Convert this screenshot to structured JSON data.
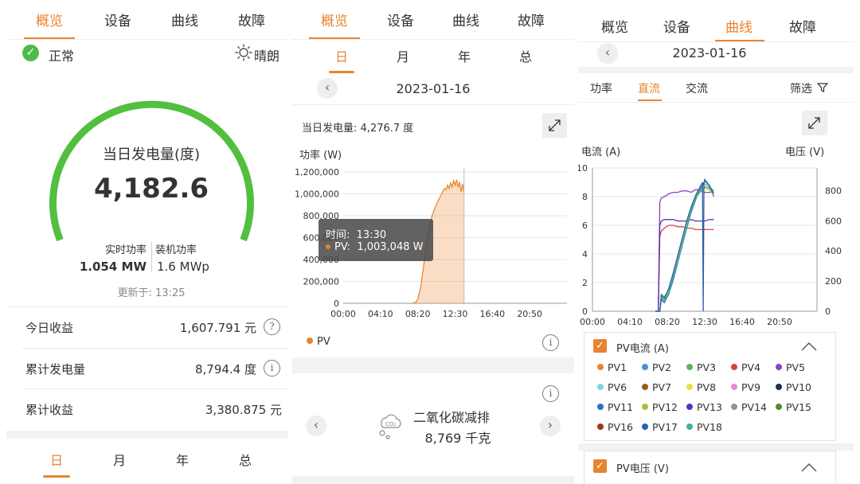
{
  "panel1": {
    "tabs": [
      "概览",
      "设备",
      "曲线",
      "故障"
    ],
    "active_tab": 0,
    "status_text": "正常",
    "weather_text": "晴朗",
    "gauge_title": "当日发电量(度)",
    "gauge_value": "4,182.6",
    "realtime_power_label": "实时功率",
    "realtime_power_value": "1.054",
    "realtime_power_unit": "MW",
    "installed_power_label": "装机功率",
    "installed_power_value": "1.6",
    "installed_power_unit": "MWp",
    "updated_label": "更新于:",
    "updated_time": "13:25",
    "rows": [
      {
        "label": "今日收益",
        "value": "1,607.791 元"
      },
      {
        "label": "累计发电量",
        "value": "8,794.4 度"
      },
      {
        "label": "累计收益",
        "value": "3,380.875 元"
      }
    ],
    "bottom_tabs": [
      "日",
      "月",
      "年",
      "总"
    ]
  },
  "panel2": {
    "tabs": [
      "概览",
      "设备",
      "曲线",
      "故障"
    ],
    "active_tab": 0,
    "period_tabs": [
      "日",
      "月",
      "年",
      "总"
    ],
    "date": "2023-01-16",
    "energy_label": "当日发电量:",
    "energy_value": "4,276.7 度",
    "ylabel": "功率 (W)",
    "tooltip_time_label": "时间:",
    "tooltip_time": "13:30",
    "tooltip_series": "PV:",
    "tooltip_value": "1,003,048 W",
    "legend_label": "PV",
    "co2_title": "二氧化碳减排",
    "co2_value": "8,769 千克"
  },
  "panel3": {
    "tabs": [
      "概览",
      "设备",
      "曲线",
      "故障"
    ],
    "active_tab": 2,
    "date": "2023-01-16",
    "sub_tabs": [
      "功率",
      "直流",
      "交流"
    ],
    "active_sub_tab": 1,
    "filter_label": "筛选",
    "left_axis_label": "电流 (A)",
    "right_axis_label": "电压 (V)",
    "group1_title": "PV电流 (A)",
    "group2_title": "PV电压 (V)",
    "pv_legend": [
      {
        "name": "PV1",
        "color": "#e8842e"
      },
      {
        "name": "PV2",
        "color": "#4a90d9"
      },
      {
        "name": "PV3",
        "color": "#5bb55b"
      },
      {
        "name": "PV4",
        "color": "#d9453e"
      },
      {
        "name": "PV5",
        "color": "#8e3fc4"
      },
      {
        "name": "PV6",
        "color": "#7fd8d4"
      },
      {
        "name": "PV7",
        "color": "#9a5a1c"
      },
      {
        "name": "PV8",
        "color": "#e6e04a"
      },
      {
        "name": "PV9",
        "color": "#e88ad6"
      },
      {
        "name": "PV10",
        "color": "#1f2f55"
      },
      {
        "name": "PV11",
        "color": "#2f6fc4"
      },
      {
        "name": "PV12",
        "color": "#a6c23a"
      },
      {
        "name": "PV13",
        "color": "#5a2fc4"
      },
      {
        "name": "PV14",
        "color": "#8a96a4"
      },
      {
        "name": "PV15",
        "color": "#4f8c2a"
      },
      {
        "name": "PV16",
        "color": "#9c3a1a"
      },
      {
        "name": "PV17",
        "color": "#2c5fa8"
      },
      {
        "name": "PV18",
        "color": "#46b0a0"
      }
    ]
  },
  "chart_data": [
    {
      "type": "area",
      "ylabel": "功率 (W)",
      "x_ticks": [
        "00:00",
        "04:10",
        "08:20",
        "12:30",
        "16:40",
        "20:50"
      ],
      "y_ticks": [
        "0",
        "200,000",
        "400,000",
        "600,000",
        "800,000",
        "1,000,000",
        "1,200,000"
      ],
      "ylim": [
        0,
        1200000
      ],
      "series": [
        {
          "name": "PV",
          "color": "#e8842e",
          "x": [
            "07:45",
            "08:00",
            "08:10",
            "08:20",
            "08:30",
            "08:40",
            "08:50",
            "09:00",
            "09:10",
            "09:20",
            "09:30",
            "09:40",
            "09:50",
            "10:00",
            "10:15",
            "10:30",
            "10:45",
            "11:00",
            "11:10",
            "11:20",
            "11:30",
            "11:40",
            "11:50",
            "12:00",
            "12:10",
            "12:20",
            "12:30",
            "12:40",
            "12:50",
            "13:00",
            "13:10",
            "13:20",
            "13:30"
          ],
          "values": [
            0,
            5000,
            15000,
            40000,
            90000,
            160000,
            250000,
            350000,
            450000,
            550000,
            640000,
            710000,
            770000,
            820000,
            870000,
            920000,
            960000,
            1000000,
            1030000,
            1050000,
            1040000,
            1080000,
            1050000,
            1100000,
            1060000,
            1120000,
            1080000,
            1130000,
            1060000,
            1110000,
            1020000,
            1090000,
            1003048
          ]
        }
      ]
    },
    {
      "type": "line",
      "x_ticks": [
        "00:00",
        "04:10",
        "08:20",
        "12:30",
        "16:40",
        "20:50"
      ],
      "left_ylabel": "电流 (A)",
      "right_ylabel": "电压 (V)",
      "left_ticks": [
        "0",
        "2",
        "4",
        "6",
        "8",
        "10"
      ],
      "right_ticks": [
        "0",
        "200",
        "400",
        "600",
        "800"
      ],
      "ylim_left": [
        0,
        10
      ],
      "ylim_right": [
        0,
        950
      ],
      "series": [
        {
          "name": "PV5",
          "color": "#8e3fc4",
          "x": [
            "07:00",
            "07:20",
            "07:30",
            "07:40",
            "08:00",
            "08:30",
            "09:00",
            "09:30",
            "10:00",
            "10:30",
            "11:00",
            "11:30",
            "12:00",
            "12:30",
            "13:00",
            "13:30"
          ],
          "values": [
            0,
            0,
            7.6,
            7.9,
            8.0,
            8.2,
            8.3,
            8.3,
            8.4,
            8.4,
            8.3,
            8.5,
            8.4,
            8.3,
            8.3,
            8.3
          ]
        },
        {
          "name": "PV4",
          "color": "#d9453e",
          "x": [
            "07:00",
            "07:20",
            "07:30",
            "07:40",
            "08:00",
            "08:30",
            "09:00",
            "09:30",
            "10:00",
            "10:30",
            "11:00",
            "11:30",
            "12:00",
            "12:30",
            "13:00",
            "13:30"
          ],
          "values": [
            0,
            0,
            5.2,
            5.6,
            5.8,
            6.0,
            6.0,
            5.9,
            5.9,
            5.8,
            5.8,
            5.7,
            5.7,
            5.7,
            5.7,
            5.7
          ]
        },
        {
          "name": "PV13",
          "color": "#5a2fc4",
          "x": [
            "07:00",
            "07:20",
            "07:30",
            "07:40",
            "08:00",
            "08:30",
            "09:00",
            "09:30",
            "10:00",
            "10:30",
            "11:00",
            "11:30",
            "12:00",
            "12:30",
            "13:00",
            "13:30"
          ],
          "values": [
            0,
            0,
            6.0,
            6.3,
            6.4,
            6.4,
            6.4,
            6.3,
            6.3,
            6.3,
            6.4,
            6.3,
            6.3,
            6.3,
            6.4,
            6.4
          ]
        },
        {
          "name": "PV3",
          "color": "#5bb55b",
          "x": [
            "07:00",
            "07:20",
            "07:30",
            "07:40",
            "08:00",
            "08:30",
            "09:00",
            "09:30",
            "10:00",
            "10:30",
            "11:00",
            "11:30",
            "12:00",
            "12:30",
            "13:00",
            "13:30"
          ],
          "values": [
            0,
            0,
            0,
            1.2,
            1.0,
            1.5,
            2.5,
            3.8,
            5.0,
            6.2,
            7.2,
            8.0,
            8.6,
            8.9,
            8.7,
            8.4
          ]
        },
        {
          "name": "PV11",
          "color": "#2f6fc4",
          "x": [
            "07:00",
            "07:20",
            "07:30",
            "07:40",
            "08:00",
            "08:30",
            "09:00",
            "09:30",
            "10:00",
            "10:30",
            "11:00",
            "11:30",
            "12:00",
            "12:30",
            "13:00",
            "13:30"
          ],
          "values": [
            0,
            0,
            0,
            0.8,
            0.6,
            1.2,
            2.2,
            3.4,
            4.6,
            5.8,
            6.9,
            7.8,
            8.5,
            9.1,
            8.8,
            8.0
          ]
        },
        {
          "name": "PV12",
          "color": "#a6c23a",
          "x": [
            "07:00",
            "07:20",
            "07:30",
            "07:40",
            "08:00",
            "08:30",
            "09:00",
            "09:30",
            "10:00",
            "10:30",
            "11:00",
            "11:30",
            "12:00",
            "12:30",
            "13:00",
            "13:30"
          ],
          "values": [
            0,
            0,
            0,
            1.0,
            0.8,
            1.4,
            2.6,
            3.6,
            4.8,
            6.0,
            7.0,
            7.9,
            8.3,
            8.6,
            8.5,
            8.1
          ]
        },
        {
          "name": "PV18",
          "color": "#46b0a0",
          "x": [
            "07:00",
            "07:20",
            "07:30",
            "07:40",
            "08:00",
            "08:30",
            "09:00",
            "09:30",
            "10:00",
            "10:30",
            "11:00",
            "11:30",
            "12:00",
            "12:30",
            "13:00",
            "13:30"
          ],
          "values": [
            0,
            0,
            0,
            0.9,
            0.7,
            1.3,
            2.4,
            3.5,
            4.7,
            5.9,
            7.0,
            7.9,
            8.4,
            8.7,
            8.6,
            8.3
          ]
        },
        {
          "name": "PV17",
          "color": "#2c5fa8",
          "x": [
            "07:00",
            "07:20",
            "07:30",
            "07:40",
            "08:00",
            "08:30",
            "09:00",
            "09:30",
            "10:00",
            "10:30",
            "11:00",
            "11:30",
            "12:00",
            "12:15",
            "12:20",
            "12:25",
            "12:30",
            "13:00",
            "13:30"
          ],
          "values": [
            0,
            0,
            0,
            1.1,
            0.9,
            1.6,
            2.7,
            3.9,
            5.1,
            6.3,
            7.3,
            8.1,
            8.7,
            9.0,
            0,
            8.9,
            9.2,
            8.8,
            8.2
          ]
        }
      ]
    }
  ]
}
